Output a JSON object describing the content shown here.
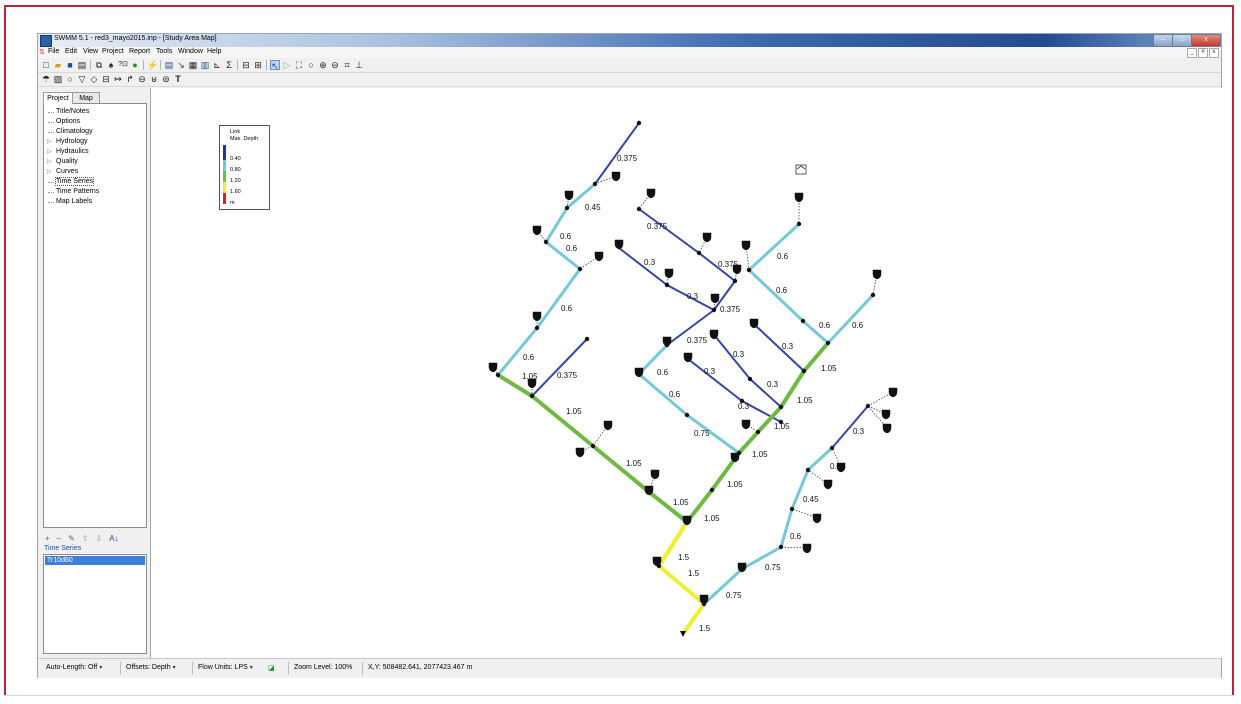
{
  "window": {
    "title": "SWMM 5.1 - red3_mayo2015.inp - [Study Area Map]",
    "buttons": {
      "minimize": "–",
      "maximize": "□",
      "close": "x"
    }
  },
  "menu": {
    "items": [
      "File",
      "Edit",
      "View",
      "Project",
      "Report",
      "Tools",
      "Window",
      "Help"
    ],
    "mdi_controls": [
      "_",
      "#",
      "x"
    ]
  },
  "toolbar1": [
    "new-icon",
    "open-icon",
    "save-icon",
    "print-icon",
    "copy-icon",
    "find-icon",
    "query-icon",
    "run-icon",
    "calibrate-icon",
    "status-report-icon",
    "profile-plot-icon",
    "time-series-icon",
    "table-icon",
    "scatter-icon",
    "statistics-icon",
    "options-icon",
    "window-tile-icon",
    "select-object-icon",
    "select-vertex-icon",
    "select-region-icon",
    "select-all-icon",
    "pan-icon",
    "zoom-in-icon",
    "zoom-out-icon",
    "full-extent-icon",
    "measure-icon"
  ],
  "toolbar2": [
    "raingage-icon",
    "subcatchment-icon",
    "junction-icon",
    "outfall-icon",
    "divider-icon",
    "storage-icon",
    "conduit-icon",
    "pump-icon",
    "orifice-icon",
    "weir-icon",
    "outlet-icon",
    "label-icon"
  ],
  "left_panel": {
    "tabs": [
      "Project",
      "Map"
    ],
    "tree": [
      {
        "label": "Title/Notes",
        "expandable": false
      },
      {
        "label": "Options",
        "expandable": false
      },
      {
        "label": "Climatology",
        "expandable": false
      },
      {
        "label": "Hydrology",
        "expandable": true
      },
      {
        "label": "Hydraulics",
        "expandable": true
      },
      {
        "label": "Quality",
        "expandable": true
      },
      {
        "label": "Curves",
        "expandable": true
      },
      {
        "label": "Time Series",
        "expandable": false
      },
      {
        "label": "Time Patterns",
        "expandable": false
      },
      {
        "label": "Map Labels",
        "expandable": false
      }
    ],
    "selected": "Time Series",
    "list_toolbar": [
      "+",
      "–",
      "✎",
      "⇧",
      "⇩",
      "A↓"
    ],
    "list_header": "Time Series",
    "list_items": [
      "Tr10d60"
    ]
  },
  "legend": {
    "title1": "Link",
    "title2": "Max. Depth",
    "breaks": [
      "0.40",
      "0.80",
      "1.20",
      "1.60"
    ],
    "unit": "m",
    "colors": [
      "#27359a",
      "#6ccbd8",
      "#73bd46",
      "#f3ed2f",
      "#d1232a"
    ]
  },
  "map": {
    "colors": {
      "blue": "#3345a6",
      "cyan": "#74c8d8",
      "green": "#6eb93f",
      "yellow": "#eef02f"
    },
    "link_labels": [
      "0.375",
      "0.45",
      "0.6",
      "0.6",
      "0.6",
      "0.6",
      "1.05",
      "0.375",
      "1.05",
      "1.05",
      "1.05",
      "1.05",
      "0.375",
      "0.375",
      "0.3",
      "0.3",
      "0.375",
      "0.375",
      "0.6",
      "0.6",
      "0.75",
      "0.3",
      "0.3",
      "0.3",
      "0.3",
      "0.3",
      "0.6",
      "0.6",
      "0.6",
      "0.6",
      "1.05",
      "1.05",
      "1.05",
      "1.05",
      "1.05",
      "1.5",
      "1.5",
      "0.75",
      "1.5",
      "0.75",
      "0.6",
      "0.45",
      "0.45",
      "0.3"
    ]
  },
  "status": {
    "auto_length": "Auto-Length: Off",
    "offsets": "Offsets: Depth",
    "flow_units": "Flow Units: LPS",
    "zoom": "Zoom Level: 100%",
    "coords": "X,Y: 508482.641, 2077423.467 m"
  }
}
